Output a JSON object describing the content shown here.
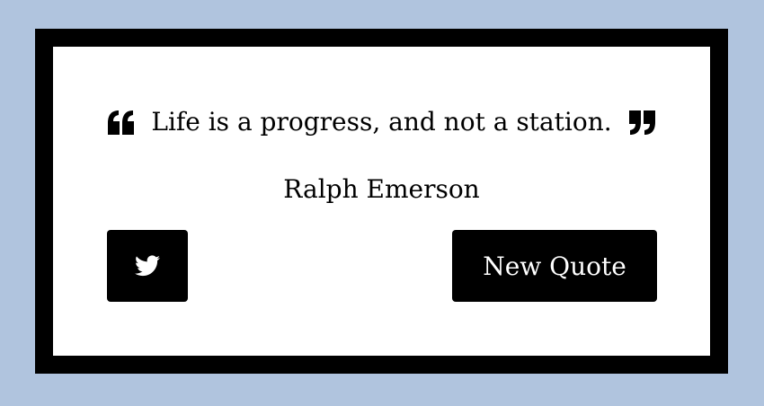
{
  "quote": {
    "text": "Life is a progress, and not a station.",
    "author": "Ralph Emerson",
    "open_icon": "quote-left-icon",
    "close_icon": "quote-right-icon"
  },
  "actions": {
    "tweet_icon": "twitter-icon",
    "new_quote_label": "New Quote"
  },
  "colors": {
    "page_background": "#b0c4de",
    "box_border": "#000000",
    "box_background": "#ffffff",
    "button_background": "#000000",
    "button_text": "#ffffff"
  }
}
